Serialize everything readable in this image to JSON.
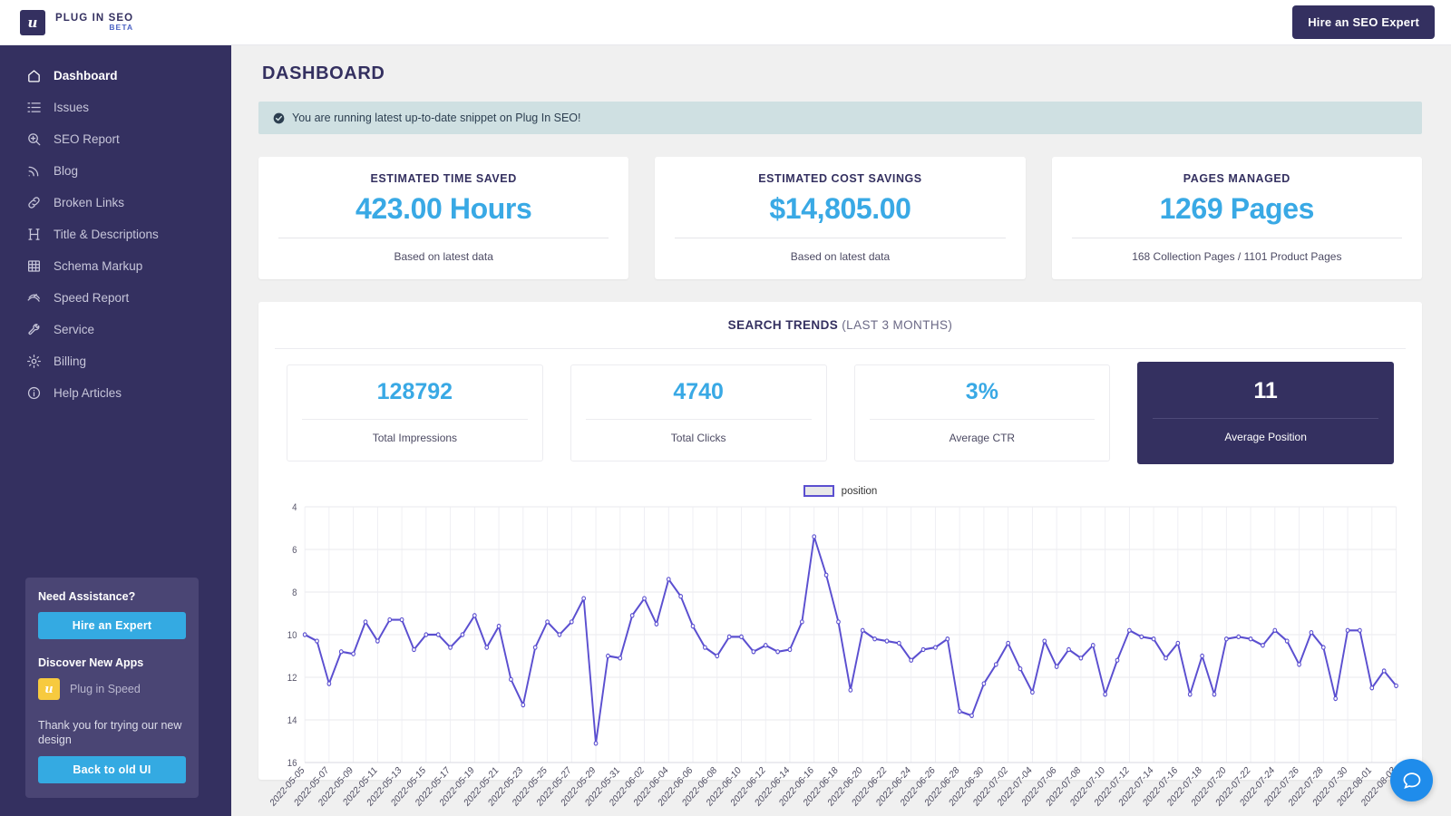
{
  "topbar": {
    "brand_name": "PLUG IN SEO",
    "brand_beta": "BETA",
    "brand_glyph": "u",
    "hire_button": "Hire an SEO Expert"
  },
  "sidebar": {
    "items": [
      {
        "label": "Dashboard",
        "icon": "home-icon",
        "active": true
      },
      {
        "label": "Issues",
        "icon": "checklist-icon",
        "active": false
      },
      {
        "label": "SEO Report",
        "icon": "magnifier-plus-icon",
        "active": false
      },
      {
        "label": "Blog",
        "icon": "rss-icon",
        "active": false
      },
      {
        "label": "Broken Links",
        "icon": "link-icon",
        "active": false
      },
      {
        "label": "Title & Descriptions",
        "icon": "heading-icon",
        "active": false
      },
      {
        "label": "Schema Markup",
        "icon": "table-grid-icon",
        "active": false
      },
      {
        "label": "Speed Report",
        "icon": "speedometer-icon",
        "active": false
      },
      {
        "label": "Service",
        "icon": "wrench-icon",
        "active": false
      },
      {
        "label": "Billing",
        "icon": "gear-icon",
        "active": false
      },
      {
        "label": "Help Articles",
        "icon": "info-circle-icon",
        "active": false
      }
    ],
    "assist": {
      "need_title": "Need Assistance?",
      "hire_button": "Hire an Expert",
      "discover_title": "Discover New Apps",
      "app_name": "Plug in Speed",
      "app_glyph": "u",
      "thanks_note": "Thank you for trying our new design",
      "old_ui_button": "Back to old UI"
    }
  },
  "main": {
    "page_title": "DASHBOARD",
    "alert": {
      "icon": "check-circle-icon",
      "text": "You are running latest up-to-date snippet on Plug In SEO!"
    },
    "stats": [
      {
        "label": "ESTIMATED TIME SAVED",
        "value": "423.00 Hours",
        "sub": "Based on latest data"
      },
      {
        "label": "ESTIMATED COST SAVINGS",
        "value": "$14,805.00",
        "sub": "Based on latest data"
      },
      {
        "label": "PAGES MANAGED",
        "value": "1269 Pages",
        "sub": "168 Collection Pages / 1101 Product Pages"
      }
    ],
    "trends": {
      "title": "SEARCH TRENDS",
      "subtitle": " (LAST 3 MONTHS)",
      "metrics": [
        {
          "value": "128792",
          "label": "Total Impressions",
          "highlighted": false
        },
        {
          "value": "4740",
          "label": "Total Clicks",
          "highlighted": false
        },
        {
          "value": "3%",
          "label": "Average CTR",
          "highlighted": false
        },
        {
          "value": "11",
          "label": "Average Position",
          "highlighted": true
        }
      ]
    },
    "chat_bubble_icon": "chat-icon"
  },
  "colors": {
    "brand_navy": "#343060",
    "accent_blue": "#39a9e5",
    "chart_line": "#5b4fd0",
    "alert_bg": "#cfe0e2",
    "sidebar_card": "#4a4574",
    "app_yellow": "#f7ca3f",
    "chat_blue": "#1f8ceb"
  },
  "chart_data": {
    "type": "line",
    "title": "",
    "xlabel": "",
    "ylabel": "",
    "ylim": [
      4,
      16
    ],
    "y_inverted": true,
    "yticks": [
      4,
      6,
      8,
      10,
      12,
      14,
      16
    ],
    "grid": true,
    "legend": [
      {
        "name": "position",
        "color": "#5b4fd0"
      }
    ],
    "legend_position": "top-center",
    "x": [
      "2022-05-05",
      "2022-05-06",
      "2022-05-07",
      "2022-05-08",
      "2022-05-09",
      "2022-05-10",
      "2022-05-11",
      "2022-05-12",
      "2022-05-13",
      "2022-05-14",
      "2022-05-15",
      "2022-05-16",
      "2022-05-17",
      "2022-05-18",
      "2022-05-19",
      "2022-05-20",
      "2022-05-21",
      "2022-05-22",
      "2022-05-23",
      "2022-05-24",
      "2022-05-25",
      "2022-05-26",
      "2022-05-27",
      "2022-05-28",
      "2022-05-29",
      "2022-05-30",
      "2022-05-31",
      "2022-06-01",
      "2022-06-02",
      "2022-06-03",
      "2022-06-04",
      "2022-06-05",
      "2022-06-06",
      "2022-06-07",
      "2022-06-08",
      "2022-06-09",
      "2022-06-10",
      "2022-06-11",
      "2022-06-12",
      "2022-06-13",
      "2022-06-14",
      "2022-06-15",
      "2022-06-16",
      "2022-06-17",
      "2022-06-18",
      "2022-06-19",
      "2022-06-20",
      "2022-06-21",
      "2022-06-22",
      "2022-06-23",
      "2022-06-24",
      "2022-06-25",
      "2022-06-26",
      "2022-06-27",
      "2022-06-28",
      "2022-06-29",
      "2022-06-30",
      "2022-07-01",
      "2022-07-02",
      "2022-07-03",
      "2022-07-04",
      "2022-07-05",
      "2022-07-06",
      "2022-07-07",
      "2022-07-08",
      "2022-07-09",
      "2022-07-10",
      "2022-07-11",
      "2022-07-12",
      "2022-07-13",
      "2022-07-14",
      "2022-07-15",
      "2022-07-16",
      "2022-07-17",
      "2022-07-18",
      "2022-07-19",
      "2022-07-20",
      "2022-07-21",
      "2022-07-22",
      "2022-07-23",
      "2022-07-24",
      "2022-07-25",
      "2022-07-26",
      "2022-07-27",
      "2022-07-28",
      "2022-07-29",
      "2022-07-30",
      "2022-07-31",
      "2022-08-01",
      "2022-08-02",
      "2022-08-03"
    ],
    "xtick_labels": [
      "2022-05-05",
      "2022-05-07",
      "2022-05-09",
      "2022-05-11",
      "2022-05-13",
      "2022-05-15",
      "2022-05-17",
      "2022-05-19",
      "2022-05-21",
      "2022-05-23",
      "2022-05-25",
      "2022-05-27",
      "2022-05-29",
      "2022-05-31",
      "2022-06-02",
      "2022-06-04",
      "2022-06-06",
      "2022-06-08",
      "2022-06-10",
      "2022-06-12",
      "2022-06-14",
      "2022-06-16",
      "2022-06-18",
      "2022-06-20",
      "2022-06-22",
      "2022-06-24",
      "2022-06-26",
      "2022-06-28",
      "2022-06-30",
      "2022-07-02",
      "2022-07-04",
      "2022-07-06",
      "2022-07-08",
      "2022-07-10",
      "2022-07-12",
      "2022-07-14",
      "2022-07-16",
      "2022-07-18",
      "2022-07-20",
      "2022-07-22",
      "2022-07-24",
      "2022-07-26",
      "2022-07-28",
      "2022-07-30",
      "2022-08-01",
      "2022-08-03"
    ],
    "series": [
      {
        "name": "position",
        "color": "#5b4fd0",
        "values": [
          10.0,
          10.3,
          12.3,
          10.8,
          10.9,
          9.4,
          10.3,
          9.3,
          9.3,
          10.7,
          10.0,
          10.0,
          10.6,
          10.0,
          9.1,
          10.6,
          9.6,
          12.1,
          13.3,
          10.6,
          9.4,
          10.0,
          9.4,
          8.3,
          15.1,
          11.0,
          11.1,
          9.1,
          8.3,
          9.5,
          7.4,
          8.2,
          9.6,
          10.6,
          11.0,
          10.1,
          10.1,
          10.8,
          10.5,
          10.8,
          10.7,
          9.4,
          5.4,
          7.2,
          9.4,
          12.6,
          9.8,
          10.2,
          10.3,
          10.4,
          11.2,
          10.7,
          10.6,
          10.2,
          13.6,
          13.8,
          12.3,
          11.4,
          10.4,
          11.6,
          12.7,
          10.3,
          11.5,
          10.7,
          11.1,
          10.5,
          12.8,
          11.2,
          9.8,
          10.1,
          10.2,
          11.1,
          10.4,
          12.8,
          11.0,
          12.8,
          10.2,
          10.1,
          10.2,
          10.5,
          9.8,
          10.3,
          11.4,
          9.9,
          10.6,
          13.0,
          9.8,
          9.8,
          12.5,
          11.7,
          12.4
        ]
      }
    ]
  }
}
